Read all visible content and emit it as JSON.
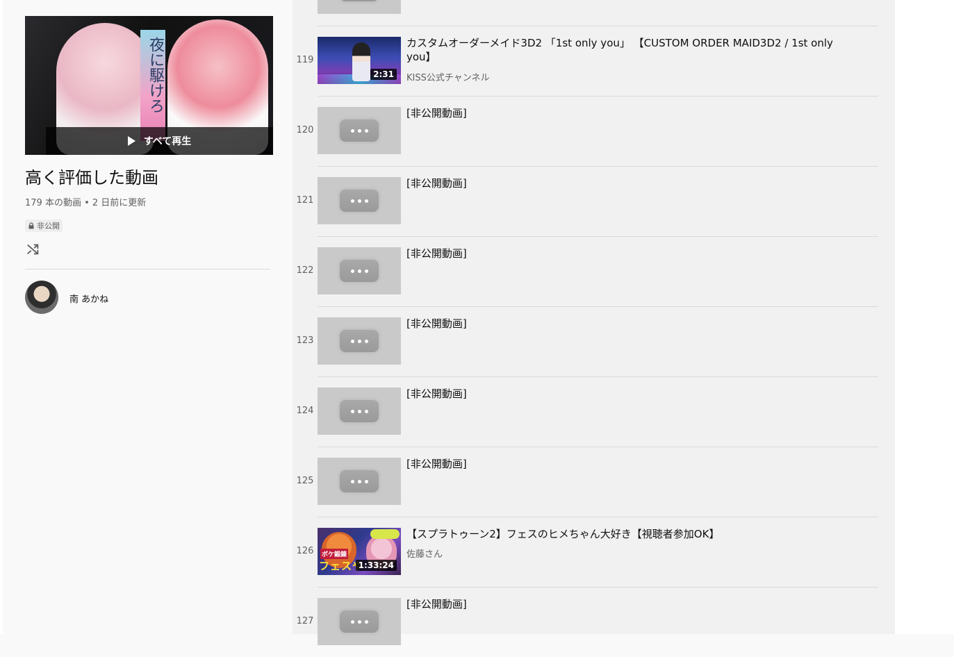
{
  "playlist": {
    "hero_text": "夜に駆けろ",
    "play_all_label": "すべて再生",
    "title": "高く評価した動画",
    "stats": "179 本の動画 • 2 日前に更新",
    "privacy": "非公開",
    "owner": "南 あかね"
  },
  "icons": {
    "play": "play-icon",
    "lock": "lock-icon",
    "shuffle": "shuffle-icon",
    "more": "more-dots-icon"
  },
  "colors": {
    "sidebar_bg": "#f9f9f9",
    "list_bg": "#f1f1f1",
    "private_thumb": "#c9c9c9",
    "secondary_text": "#606060"
  },
  "videos": [
    {
      "index": "119",
      "title": "カスタムオーダーメイド3D2 「1st only you」 【CUSTOM ORDER MAID3D2 / 1st only you】",
      "channel": "KISS公式チャンネル",
      "duration": "2:31"
    },
    {
      "index": "120",
      "title": "[非公開動画]"
    },
    {
      "index": "121",
      "title": "[非公開動画]"
    },
    {
      "index": "122",
      "title": "[非公開動画]"
    },
    {
      "index": "123",
      "title": "[非公開動画]"
    },
    {
      "index": "124",
      "title": "[非公開動画]"
    },
    {
      "index": "125",
      "title": "[非公開動画]"
    },
    {
      "index": "126",
      "title": "【スプラトゥーン2】フェスのヒメちゃん大好き【視聴者参加OK】",
      "channel": "佐藤さん",
      "duration": "1:33:24",
      "thumb_tag": "ボケ鍛錬",
      "thumb_big": "フェスや"
    },
    {
      "index": "127",
      "title": "[非公開動画]"
    }
  ]
}
